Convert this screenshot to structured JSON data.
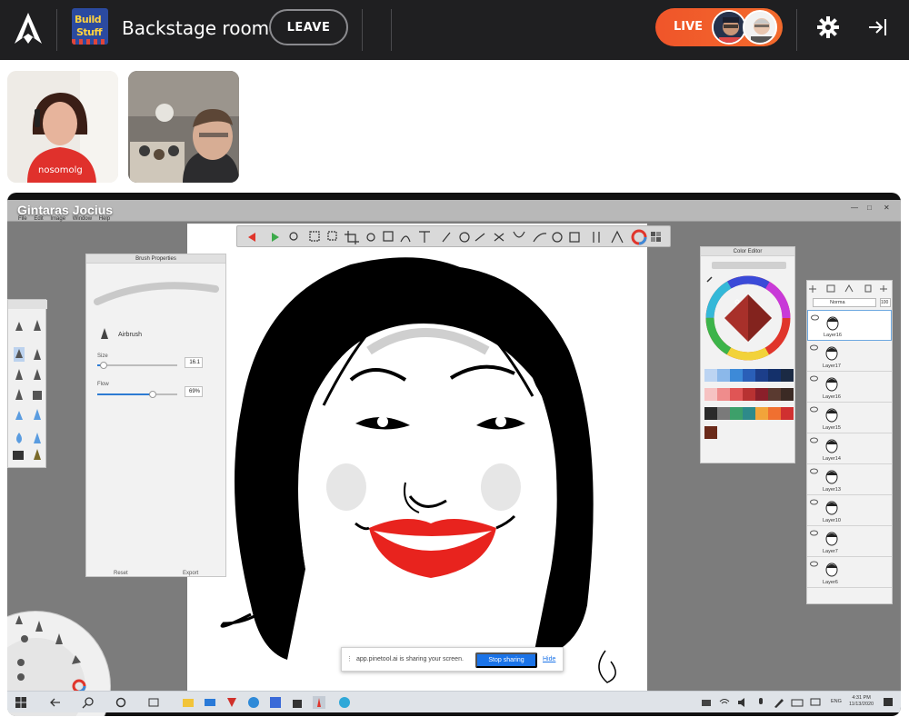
{
  "header": {
    "event_thumb_line1": "Build",
    "event_thumb_line2": "Stuff",
    "room_title": "Backstage room",
    "leave_label": "LEAVE",
    "live_label": "LIVE"
  },
  "share": {
    "sharer_name": "Gintaras Jocius",
    "app_menu": [
      "File",
      "Edit",
      "Image",
      "Window",
      "Help"
    ],
    "brush_panel": {
      "title": "Brush Properties",
      "brush_name": "Airbrush",
      "size_label": "Size",
      "size_value": "16.1",
      "size_fraction": 0.08,
      "flow_label": "Flow",
      "flow_value": "69%",
      "flow_fraction": 0.69,
      "reset_label": "Reset",
      "export_label": "Export"
    },
    "color_panel": {
      "title": "Color Editor",
      "swatches": [
        "#bcd4f2",
        "#8bb8ea",
        "#3d8ad8",
        "#2a5fb8",
        "#1c3e8a",
        "#14306a",
        "#1b2a44",
        "#f6c2c2",
        "#ef8c8c",
        "#e05555",
        "#b83232",
        "#8a1f2a",
        "#5a3a30",
        "#3b2a24",
        "#2a2a2a",
        "#7a7a7a",
        "#3da06a",
        "#2e8a8a",
        "#f2a43a",
        "#f07030",
        "#d03030",
        "#6a2a1a"
      ]
    },
    "layers_panel": {
      "blend_mode": "Norma",
      "opacity": "100",
      "layers": [
        "Layer16",
        "Layer17",
        "Layer16",
        "Layer15",
        "Layer14",
        "Layer13",
        "Layer10",
        "Layer7",
        "Layer6"
      ]
    },
    "screen_share_notice": {
      "message": "app.pinetool.ai is sharing your screen.",
      "stop_label": "Stop sharing",
      "hide_label": "Hide"
    },
    "taskbar": {
      "language": "ENG",
      "time": "4:31 PM",
      "date": "11/13/2020"
    }
  },
  "colors": {
    "topbar_bg": "#1f1f21",
    "live_orange": "#f0552a",
    "share_blue": "#1a73e8",
    "lip_red": "#e8231e"
  }
}
